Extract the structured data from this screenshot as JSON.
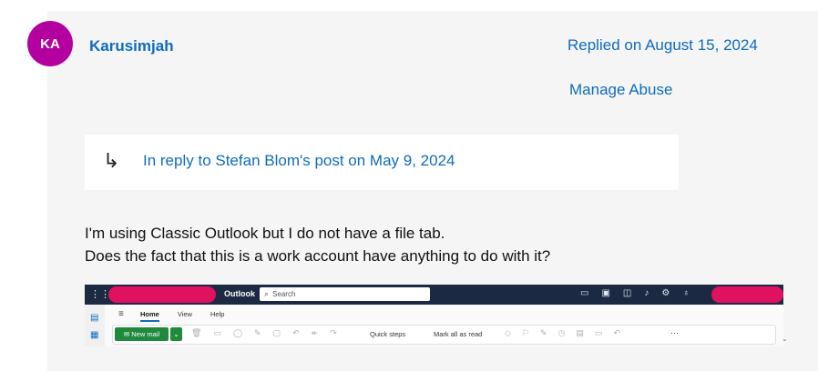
{
  "post": {
    "avatar_initials": "KA",
    "author": "Karusimjah",
    "replied": "Replied on August 15, 2024",
    "manage_abuse": "Manage Abuse"
  },
  "reply_context": {
    "arrow_icon": "reply-arrow-icon",
    "link_text": "In reply to Stefan Blom's post on May 9, 2024"
  },
  "body": {
    "line1": "I'm using Classic Outlook but I do not have a file tab.",
    "line2": "Does the fact that this is a work account have anything to do with it?"
  },
  "screenshot": {
    "app_name": "Outlook",
    "search_placeholder": "Search",
    "tabs": [
      "Home",
      "View",
      "Help"
    ],
    "new_mail": "New mail",
    "quick_steps": "Quick steps",
    "mark_all_read": "Mark all as read",
    "more": "···"
  },
  "colors": {
    "link": "#0f6cbd",
    "avatar": "#b4009e",
    "outlook_header": "#1b2a42",
    "redaction": "#e0115f",
    "new_mail_green": "#1f8a3c"
  }
}
